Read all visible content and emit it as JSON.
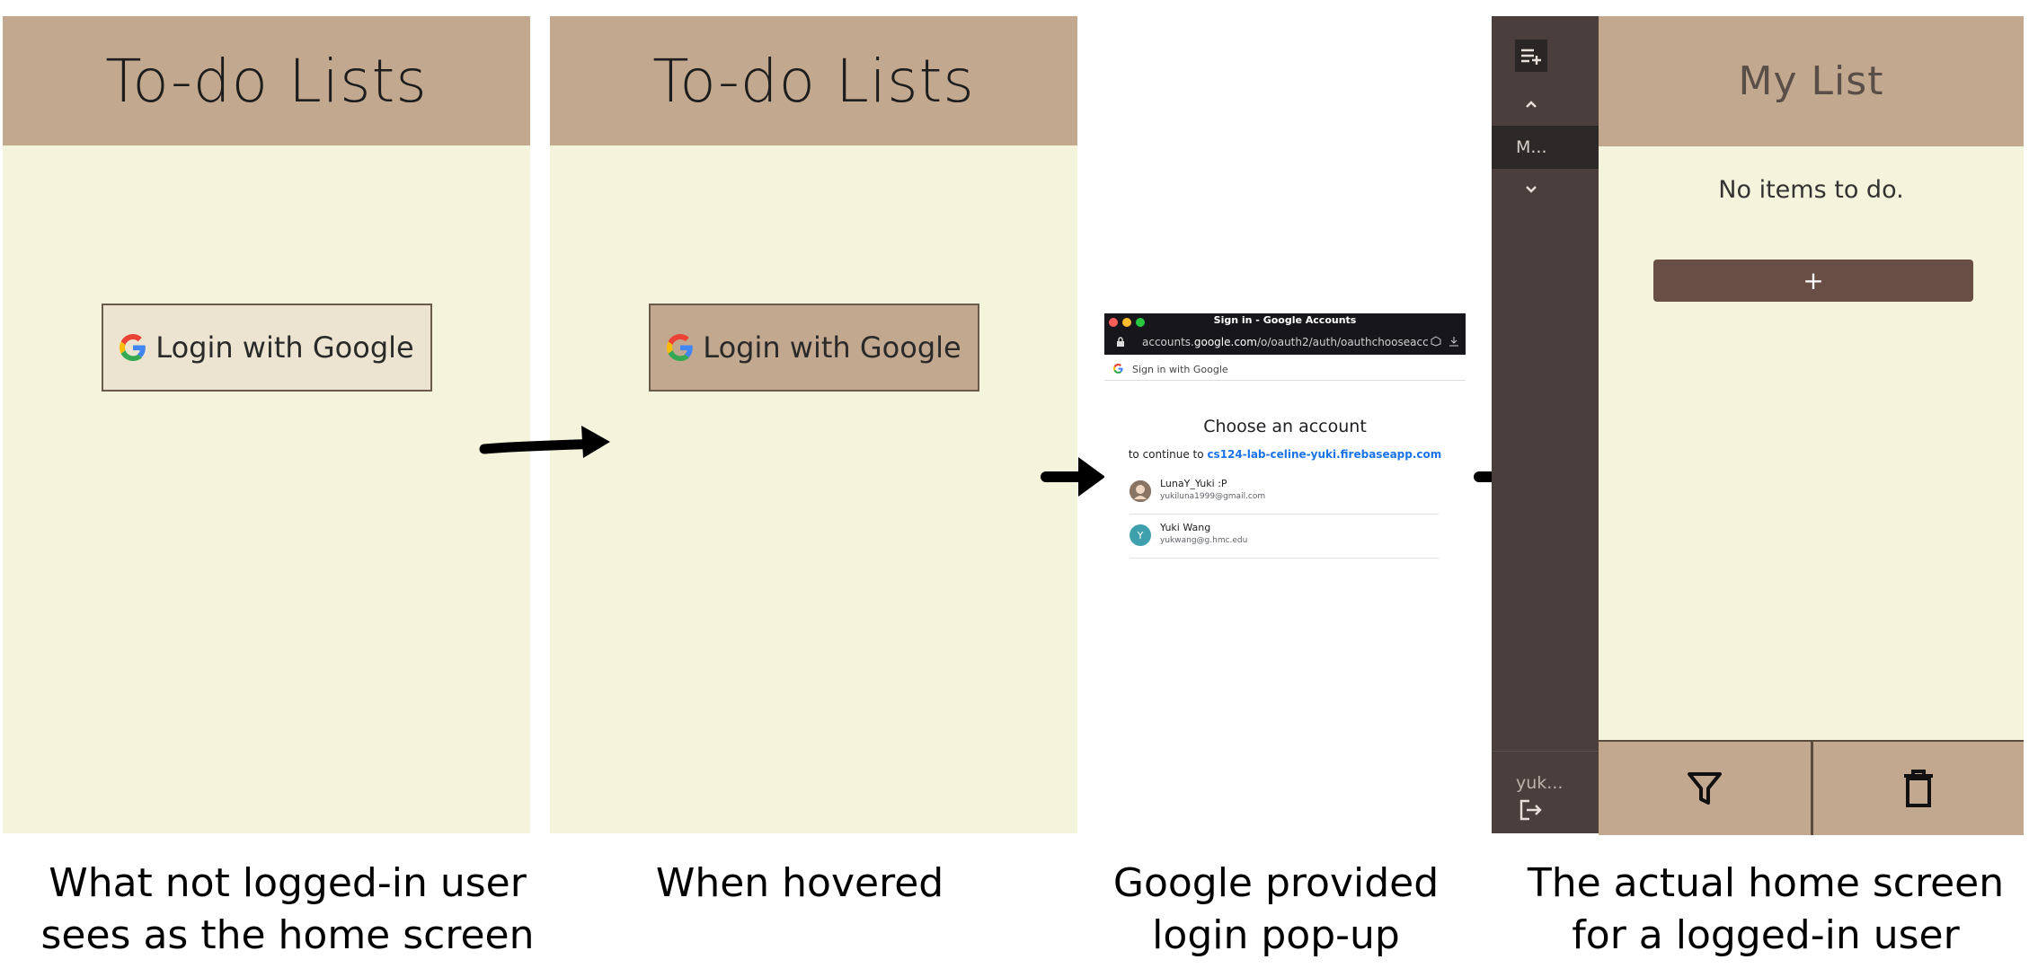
{
  "panels": [
    {
      "header": "To-do Lists",
      "login_label": "Login with Google",
      "caption_line1": "What not logged-in user",
      "caption_line2": "sees as the home screen"
    },
    {
      "header": "To-do Lists",
      "login_label": "Login with Google",
      "caption_line1": "When hovered",
      "caption_line2": ""
    }
  ],
  "popup": {
    "window_title": "Sign in - Google Accounts",
    "url_prefix": "accounts.",
    "url_domain": "google.com",
    "url_rest": "/o/oauth2/auth/oauthchooseacc",
    "signin_with": "Sign in with Google",
    "heading": "Choose an account",
    "continue_to": "to continue to",
    "continue_link": "cs124-lab-celine-yuki.firebaseapp.com",
    "accounts": [
      {
        "name": "LunaY_Yuki :P",
        "email": "yukiluna1999@gmail.com",
        "avatar": ""
      },
      {
        "name": "Yuki Wang",
        "email": "yukwang@g.hmc.edu",
        "avatar": "Y"
      }
    ],
    "caption_line1": "Google provided",
    "caption_line2": "login pop-up"
  },
  "app": {
    "sidebar_selected": "M...",
    "user": "yuk...",
    "list_title": "My List",
    "empty_text": "No items to do.",
    "add_label": "+",
    "caption_line1": "The actual home screen",
    "caption_line2": "for a logged-in user"
  },
  "colors": {
    "header_tan": "#c2a88e",
    "cream_bg": "#f4f3dc",
    "sidebar_dark": "#4a3f3c",
    "add_button": "#684e44",
    "google_link": "#1a73e8"
  }
}
